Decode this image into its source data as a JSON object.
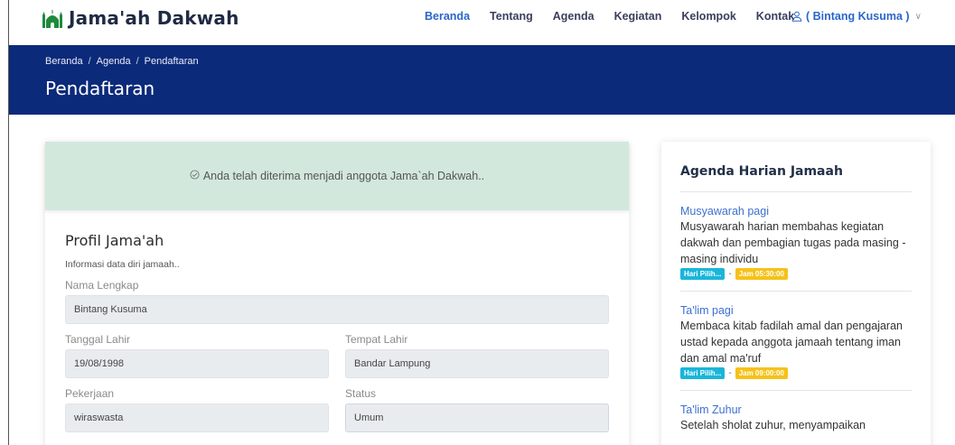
{
  "brand": {
    "name": "Jama'ah Dakwah",
    "logo_icon": "mosque-icon",
    "accent_color": "#1e8a3c"
  },
  "nav": {
    "items": [
      {
        "label": "Beranda",
        "active": true
      },
      {
        "label": "Tentang",
        "active": false
      },
      {
        "label": "Agenda",
        "active": false
      },
      {
        "label": "Kegiatan",
        "active": false
      },
      {
        "label": "Kelompok",
        "active": false
      },
      {
        "label": "Kontak",
        "active": false
      }
    ],
    "user_label": "( Bintang Kusuma )",
    "user_icon": "user-icon"
  },
  "header": {
    "breadcrumb": [
      "Beranda",
      "Agenda",
      "Pendaftaran"
    ],
    "breadcrumb_separator": "/",
    "title": "Pendaftaran",
    "background_color": "#0b2a7a"
  },
  "alert": {
    "icon": "check-circle-icon",
    "message": "Anda telah diterima menjadi anggota Jama`ah Dakwah..",
    "background_color": "#d2e8dd"
  },
  "profile": {
    "title": "Profil Jama'ah",
    "subtitle": "Informasi data diri jamaah..",
    "fields": {
      "nama_lengkap": {
        "label": "Nama Lengkap",
        "value": "Bintang Kusuma"
      },
      "tanggal_lahir": {
        "label": "Tanggal Lahir",
        "value": "19/08/1998"
      },
      "tempat_lahir": {
        "label": "Tempat Lahir",
        "value": "Bandar Lampung"
      },
      "pekerjaan": {
        "label": "Pekerjaan",
        "value": "wiraswasta"
      },
      "status": {
        "label": "Status",
        "value": "Umum"
      }
    }
  },
  "sidebar": {
    "title": "Agenda Harian Jamaah",
    "agendas": [
      {
        "name": "Musyawarah pagi",
        "description": "Musyawarah harian membahas kegiatan dakwah dan pembagian tugas pada masing - masing individu",
        "day_badge": "Hari Pilih...",
        "separator": "-",
        "time_badge": "Jam 05:30:00"
      },
      {
        "name": "Ta'lim pagi",
        "description": "Membaca kitab fadilah amal dan pengajaran ustad kepada anggota jamaah tentang iman dan amal ma'ruf",
        "day_badge": "Hari Pilih...",
        "separator": "-",
        "time_badge": "Jam 09:00:00"
      },
      {
        "name": "Ta'lim Zuhur",
        "description": "Setelah sholat zuhur, menyampaikan",
        "day_badge": "",
        "separator": "",
        "time_badge": ""
      }
    ]
  }
}
